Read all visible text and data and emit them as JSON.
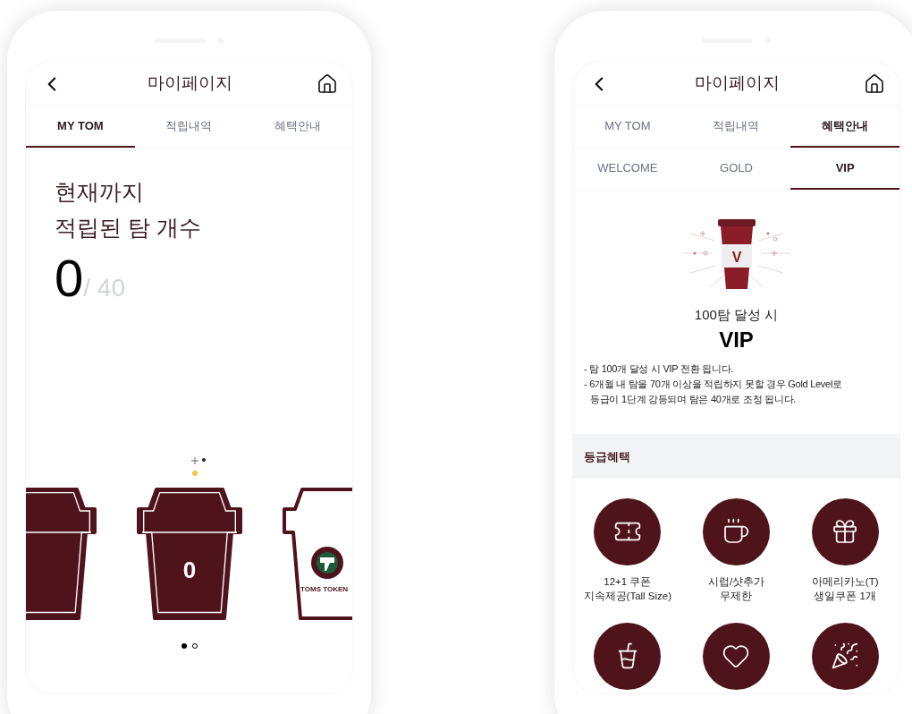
{
  "phones": [
    {
      "kind": "my_tom",
      "title": "마이페이지",
      "tabs": [
        {
          "label": "MY TOM",
          "selected": true
        },
        {
          "label": "적립내역",
          "selected": false
        },
        {
          "label": "혜택안내",
          "selected": false
        }
      ],
      "heading": [
        "현재까지",
        "적립된 탐 개수"
      ],
      "count": "0",
      "total": "/ 40",
      "cup_number": "0",
      "token_text": "TOMS TOKEN",
      "pager": [
        {
          "selected": true
        },
        {
          "selected": false
        }
      ]
    },
    {
      "kind": "benefits",
      "title": "마이페이지",
      "tabs": [
        {
          "label": "MY TOM",
          "selected": false
        },
        {
          "label": "적립내역",
          "selected": false
        },
        {
          "label": "혜택안내",
          "selected": true
        }
      ],
      "subtabs": [
        {
          "label": "WELCOME",
          "selected": false
        },
        {
          "label": "GOLD",
          "selected": false
        },
        {
          "label": "VIP",
          "selected": true
        }
      ],
      "badge_letter": "V",
      "goal": "100탐 달성 시",
      "level_name": "VIP",
      "notes": [
        {
          "lines": [
            "- 탐 100개 달성 시 VIP 전환 됩니다."
          ]
        },
        {
          "lines": [
            "- 6개월 내 탐을 70개 이상을 적립하지 못할 경우 Gold Level로",
            "등급이 1단계 강등되며 탐은 40개로 조정 됩니다."
          ]
        }
      ],
      "section_title": "등급혜택",
      "benefits": [
        {
          "kind": "labeled",
          "lines": [
            "12+1 쿠폰",
            "지속제공(Tall Size)"
          ]
        },
        {
          "kind": "labeled",
          "lines": [
            "시럽/샷추가",
            "무제한"
          ]
        },
        {
          "kind": "labeled",
          "lines": [
            "아메리카노(T)",
            "생일쿠폰 1개"
          ]
        },
        {
          "kind": "unlabeled"
        },
        {
          "kind": "unlabeled"
        },
        {
          "kind": "unlabeled"
        }
      ]
    }
  ]
}
